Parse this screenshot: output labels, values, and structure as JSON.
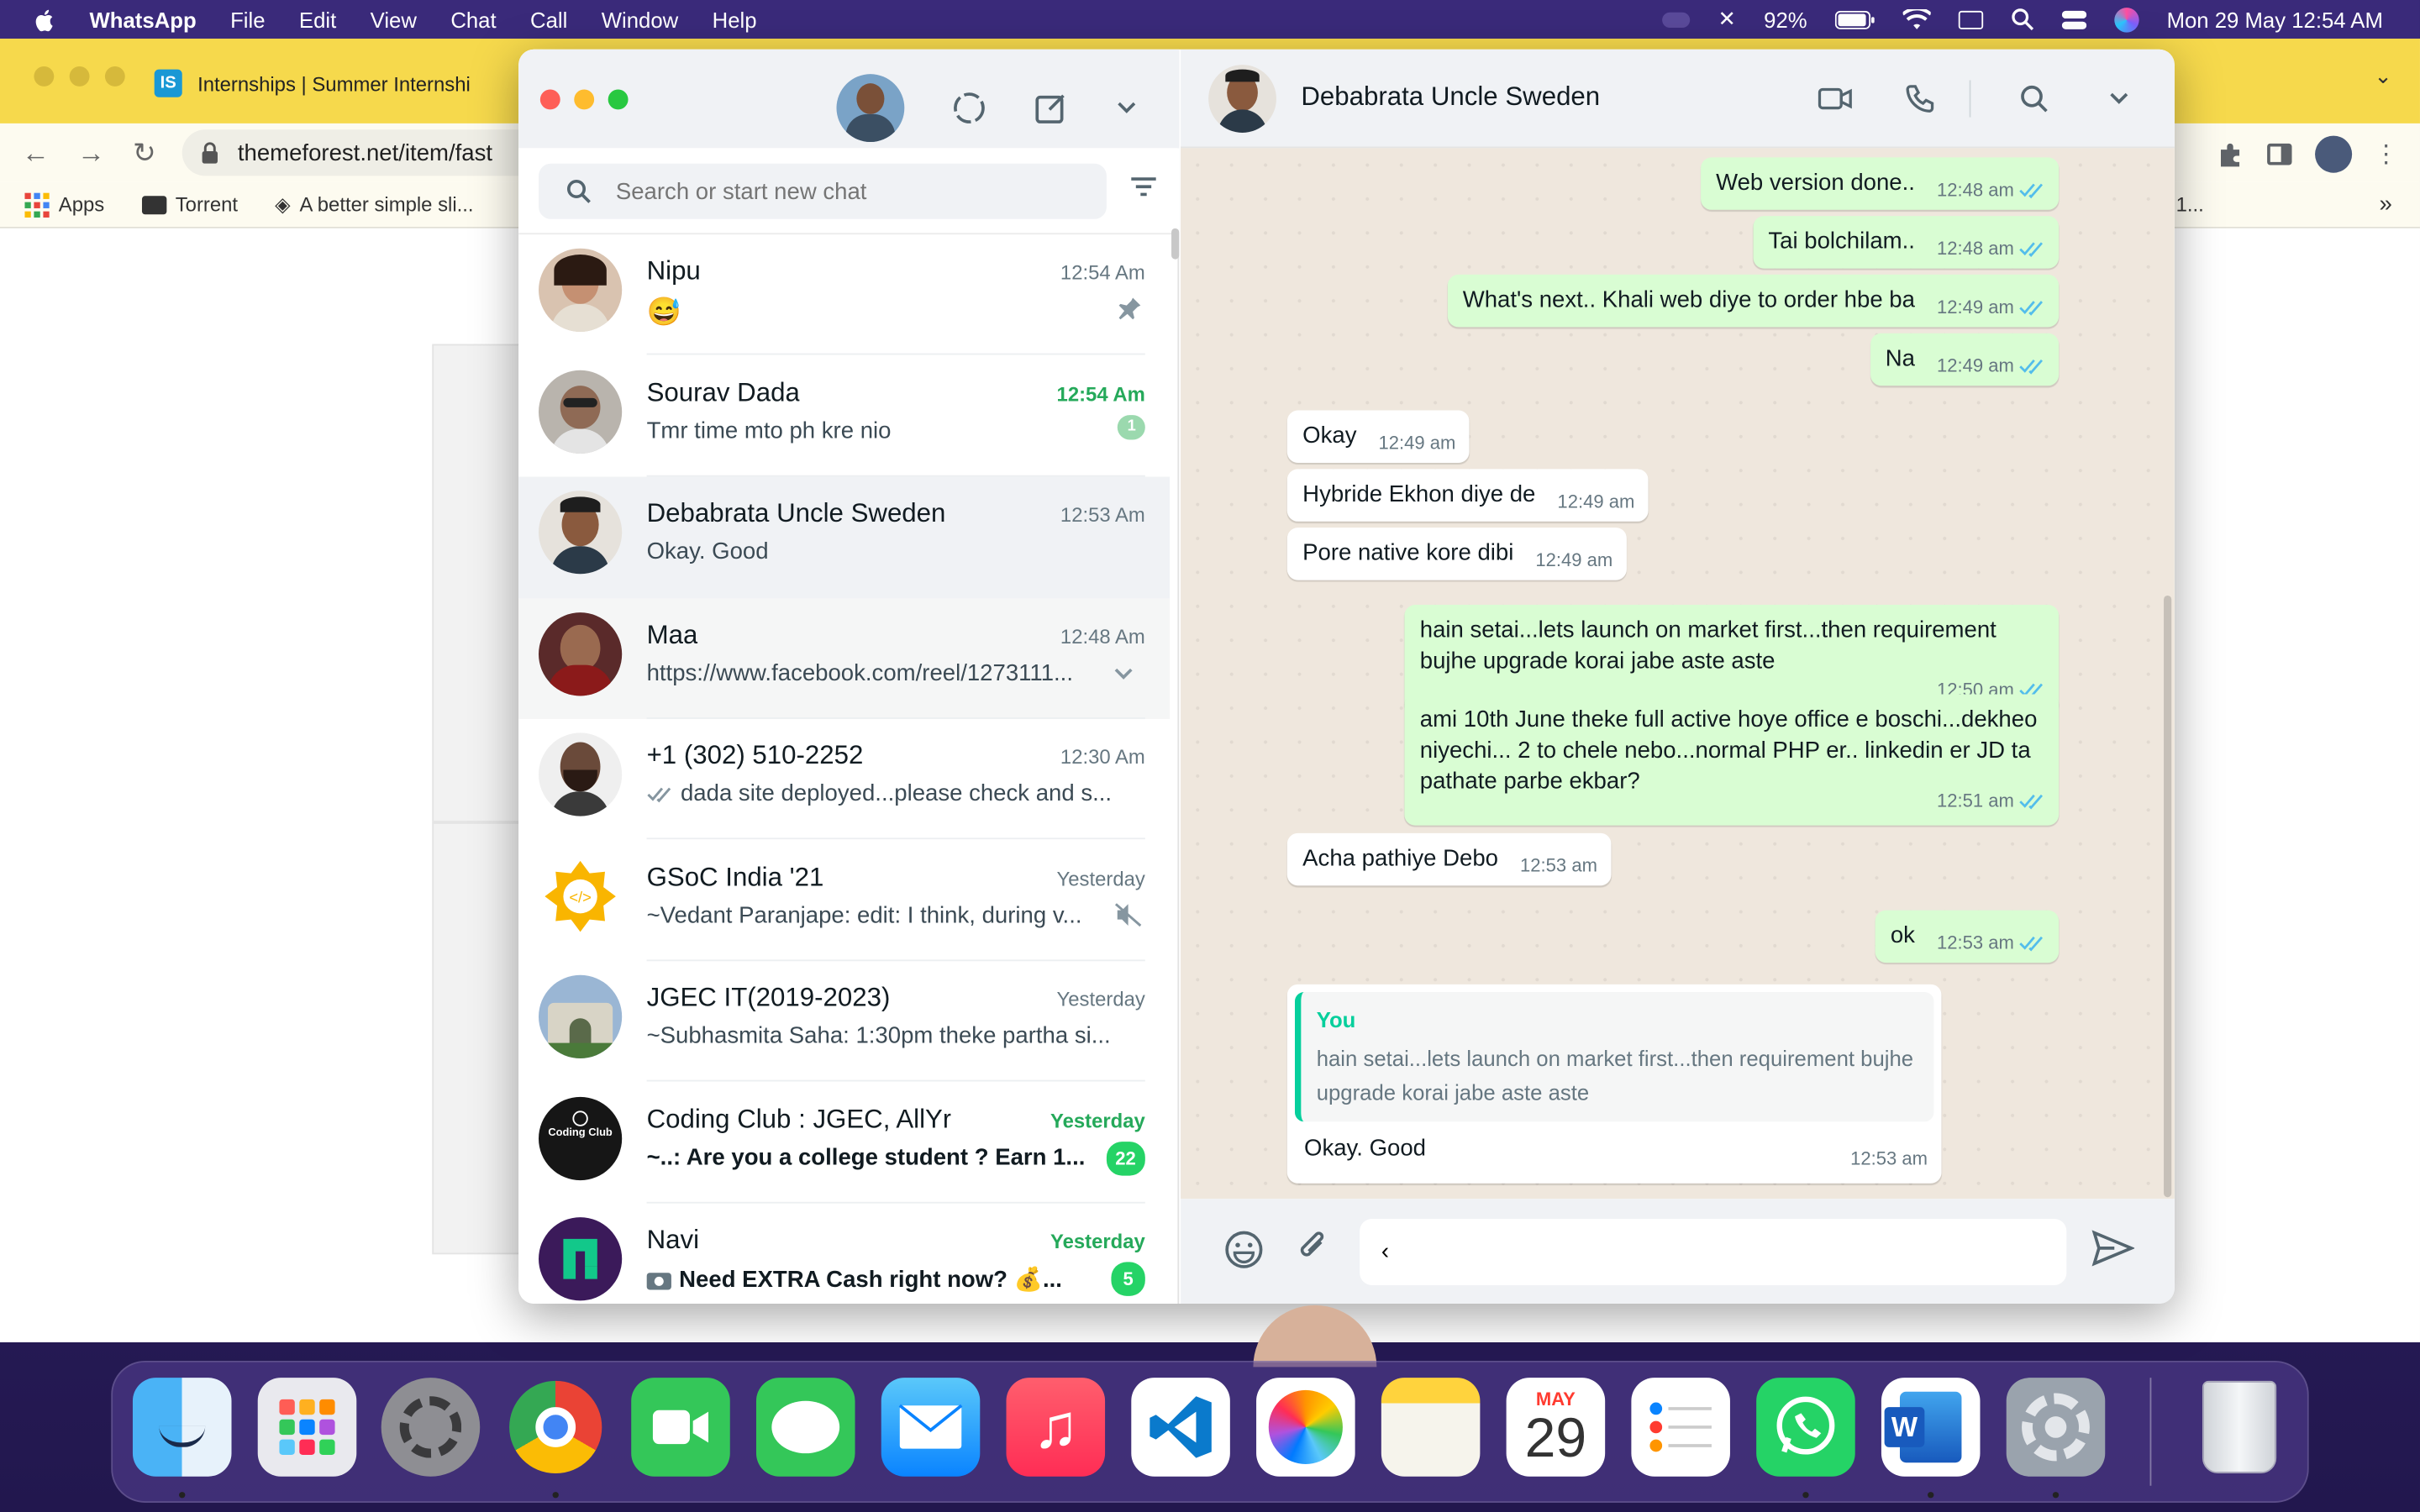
{
  "menubar": {
    "app_name": "WhatsApp",
    "items": [
      "File",
      "Edit",
      "View",
      "Chat",
      "Call",
      "Window",
      "Help"
    ],
    "battery": "92%",
    "datetime": "Mon 29 May  12:54 AM"
  },
  "browser": {
    "tab_title": "Internships | Summer Internshi",
    "tab_favicon": "IS",
    "url": "themeforest.net/item/fast",
    "bookmarks": [
      "Apps",
      "Torrent",
      "A better simple sli..."
    ],
    "bookmark_extra": "1..."
  },
  "whatsapp": {
    "search_placeholder": "Search or start new chat",
    "chats": [
      {
        "name": "Nipu",
        "time": "12:54 Am",
        "message": "😅",
        "pinned": true,
        "time_green": false
      },
      {
        "name": "Sourav Dada",
        "time": "12:54 Am",
        "message": "Tmr time mto ph kre nio",
        "unread": "1",
        "time_green": true
      },
      {
        "name": "Debabrata Uncle Sweden",
        "time": "12:53 Am",
        "message": "Okay. Good",
        "active": true
      },
      {
        "name": "Maa",
        "time": "12:48 Am",
        "message": "https://www.facebook.com/reel/1273111..."
      },
      {
        "name": "+1 (302) 510-2252",
        "time": "12:30 Am",
        "message": "dada site deployed...please check and s..."
      },
      {
        "name": "GSoC India '21",
        "time": "Yesterday",
        "message": "~Vedant Paranjape: edit: I think, during v...",
        "muted": true
      },
      {
        "name": "JGEC IT(2019-2023)",
        "time": "Yesterday",
        "message": "~Subhasmita Saha: 1:30pm theke partha si..."
      },
      {
        "name": "Coding Club : JGEC, AllYr",
        "time": "Yesterday",
        "message": "~..: Are you a college student ? Earn 1...",
        "unread": "22",
        "time_green": true
      },
      {
        "name": "Navi",
        "time": "Yesterday",
        "message": "Need EXTRA Cash right now? 💰...",
        "unread": "5",
        "time_green": true
      }
    ],
    "conversation": {
      "title": "Debabrata Uncle Sweden",
      "messages": [
        {
          "dir": "out",
          "text": "Web version done..",
          "time": "12:48 am"
        },
        {
          "dir": "out",
          "text": "Tai bolchilam..",
          "time": "12:48 am"
        },
        {
          "dir": "out",
          "text": "What's next.. Khali web diye to order hbe ba",
          "time": "12:49 am"
        },
        {
          "dir": "out",
          "text": "Na",
          "time": "12:49 am"
        },
        {
          "dir": "in",
          "text": "Okay",
          "time": "12:49 am"
        },
        {
          "dir": "in",
          "text": "Hybride Ekhon diye de",
          "time": "12:49 am"
        },
        {
          "dir": "in",
          "text": "Pore native kore dibi",
          "time": "12:49 am"
        },
        {
          "dir": "out",
          "text": "hain setai...lets launch on market first...then requirement bujhe upgrade korai jabe aste aste",
          "time": "12:50 am"
        },
        {
          "dir": "out",
          "text": "ami 10th June theke full active hoye office e boschi...dekheo niyechi... 2 to chele nebo...normal PHP er.. linkedin er JD ta pathate parbe ekbar?",
          "time": "12:51 am"
        },
        {
          "dir": "in",
          "text": "Acha pathiye Debo",
          "time": "12:53 am"
        },
        {
          "dir": "out",
          "text": "ok",
          "time": "12:53 am"
        },
        {
          "dir": "in",
          "text": "Okay. Good",
          "time": "12:53 am",
          "quote_author": "You",
          "quote_text": "hain setai...lets launch on market first...then requirement bujhe upgrade korai jabe aste aste"
        }
      ],
      "composer_value": "‹"
    }
  },
  "dock": {
    "calendar_month": "MAY",
    "calendar_day": "29",
    "apps": [
      "Finder",
      "Launchpad",
      "System Preferences",
      "Google Chrome",
      "FaceTime",
      "Messages",
      "Mail",
      "Music",
      "Visual Studio Code",
      "Photos",
      "Notes",
      "Calendar",
      "Reminders",
      "WhatsApp",
      "Microsoft Word",
      "System Settings",
      "Trash"
    ]
  },
  "colors": {
    "whatsapp_green": "#25d366",
    "outgoing_bubble": "#d9fdd3",
    "chat_background": "#efe7dd",
    "menubar": "#3a2a7a",
    "browser_tab_strip": "#f6d94c"
  }
}
